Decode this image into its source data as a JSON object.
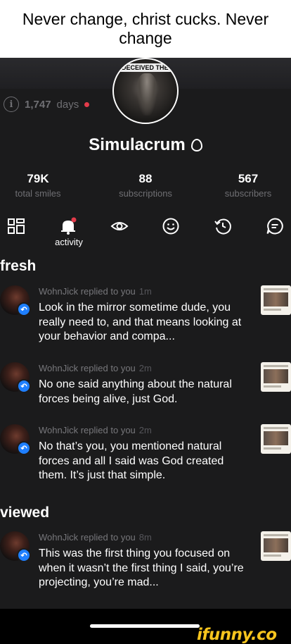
{
  "caption": "Never change, christ cucks. Never change",
  "profile": {
    "banner_text": "DECEIVED THE",
    "days_count": "1,747",
    "days_label": "days",
    "username": "Simulacrum",
    "stats": [
      {
        "value": "79K",
        "label": "total smiles"
      },
      {
        "value": "88",
        "label": "subscriptions"
      },
      {
        "value": "567",
        "label": "subscribers"
      }
    ]
  },
  "tabs": {
    "active_label": "activity",
    "icons": [
      "grid-icon",
      "bell-icon",
      "eye-icon",
      "smile-icon",
      "history-icon",
      "comment-icon"
    ]
  },
  "sections": {
    "fresh": "fresh",
    "viewed": "viewed"
  },
  "notifications": [
    {
      "who": "WohnJick replied to you",
      "ago": "1m",
      "text": "Look in the mirror sometime dude, you really need to, and that means looking at your behavior and compa..."
    },
    {
      "who": "WohnJick replied to you",
      "ago": "2m",
      "text": "No one said anything about the natural forces being alive, just God."
    },
    {
      "who": "WohnJick replied to you",
      "ago": "2m",
      "text": "No that’s you, you mentioned natural forces and all I said was God created them. It’s just that simple."
    },
    {
      "who": "WohnJick replied to you",
      "ago": "8m",
      "text": "This was the first thing you focused on when it wasn’t the first thing I said, you’re projecting, you’re mad..."
    }
  ],
  "watermark": "ifunny.co",
  "colors": {
    "accent_red": "#e33b4a",
    "badge_blue": "#1f7fff",
    "ifunny_yellow": "#f7c51e"
  }
}
